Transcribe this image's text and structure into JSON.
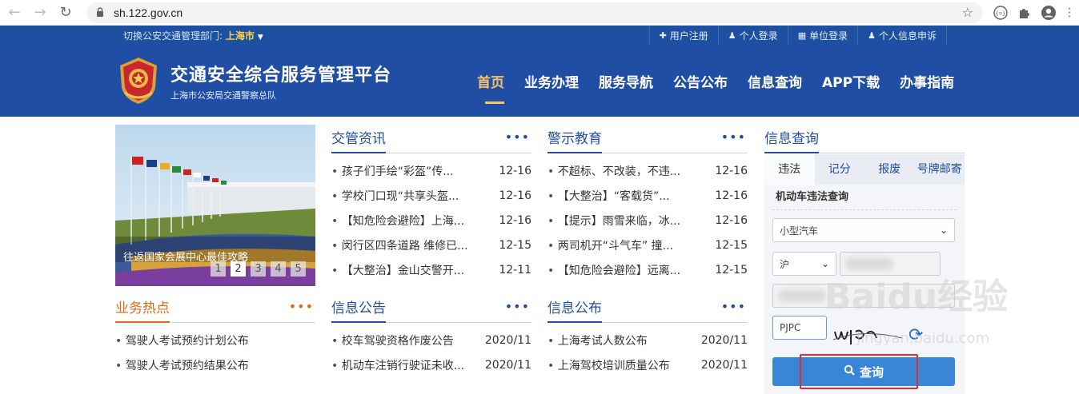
{
  "browser": {
    "url": "sh.122.gov.cn"
  },
  "topbar": {
    "switch_label": "切换公安交通管理部门:",
    "city": "上海市",
    "links": [
      {
        "label": "用户注册",
        "icon": "plus-icon"
      },
      {
        "label": "个人登录",
        "icon": "user-icon"
      },
      {
        "label": "单位登录",
        "icon": "document-icon"
      },
      {
        "label": "个人信息申诉",
        "icon": "user-icon"
      }
    ]
  },
  "header": {
    "title": "交通安全综合服务管理平台",
    "subtitle": "上海市公安局交通警察总队",
    "nav": [
      "首页",
      "业务办理",
      "服务导航",
      "公告公布",
      "信息查询",
      "APP下载",
      "办事指南"
    ]
  },
  "banner": {
    "caption": "往返国家会展中心最佳攻略",
    "pages": [
      "1",
      "2",
      "3",
      "4",
      "5"
    ],
    "active_page": "2"
  },
  "news": {
    "title": "交管资讯",
    "more": "•••",
    "items": [
      {
        "text": "孩子们手绘“彩盔”传...",
        "date": "12-16"
      },
      {
        "text": "学校门口现“共享头盔...",
        "date": "12-16"
      },
      {
        "text": "【知危险会避险】上海...",
        "date": "12-16"
      },
      {
        "text": "闵行区四条道路 维修已...",
        "date": "12-15"
      },
      {
        "text": "【大整治】金山交警开...",
        "date": "12-11"
      }
    ]
  },
  "warning": {
    "title": "警示教育",
    "more": "•••",
    "items": [
      {
        "text": "不超标、不改装，不违...",
        "date": "12-16"
      },
      {
        "text": "【大整治】“客载货”...",
        "date": "12-16"
      },
      {
        "text": "【提示】雨雪来临，冰...",
        "date": "12-16"
      },
      {
        "text": "两司机开“斗气车” 撞...",
        "date": "12-15"
      },
      {
        "text": "【知危险会避险】远离...",
        "date": "12-15"
      }
    ]
  },
  "hot": {
    "title": "业务热点",
    "more": "•••",
    "items": [
      {
        "text": "驾驶人考试预约计划公布"
      },
      {
        "text": "驾驶人考试预约结果公布"
      }
    ]
  },
  "notice": {
    "title": "信息公告",
    "more": "•••",
    "items": [
      {
        "text": "校车驾驶资格作废公告",
        "date": "2020/11"
      },
      {
        "text": "机动车注销行驶证未收...",
        "date": "2020/11"
      }
    ]
  },
  "publish": {
    "title": "信息公布",
    "more": "•••",
    "items": [
      {
        "text": "上海考试人数公布",
        "date": "2020/11"
      },
      {
        "text": "上海驾校培训质量公布",
        "date": "2020/11"
      }
    ]
  },
  "query": {
    "title": "信息查询",
    "tabs": [
      "违法",
      "记分",
      "报废",
      "号牌邮寄"
    ],
    "active_tab": "违法",
    "section_label": "机动车违法查询",
    "vehicle_type": "小型汽车",
    "plate_prefix": "沪",
    "captcha_value": "PJPC",
    "submit_label": "查询"
  },
  "watermark": {
    "brand": "Baidu经验",
    "url": "jingyan.baidu.com"
  },
  "colors": {
    "brand_blue": "#1f4ea4",
    "accent_orange": "#e06b17",
    "nav_active": "#f6c26a",
    "button_blue": "#3a86d6",
    "highlight_red": "#e02b2b"
  }
}
